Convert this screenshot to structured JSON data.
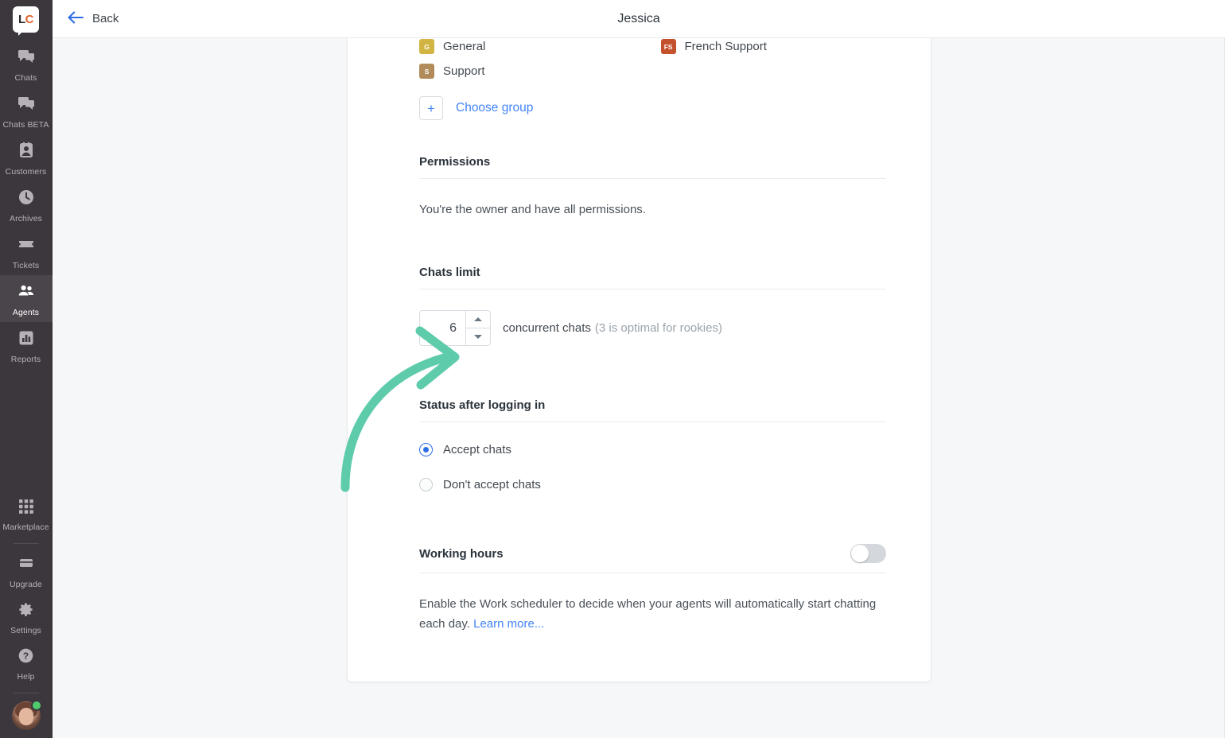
{
  "app": {
    "logo_text_left": "L",
    "logo_text_right": "C",
    "brand_color": "#e1632a"
  },
  "sidebar": {
    "items": [
      {
        "label": "Chats",
        "icon": "chats-icon",
        "active": false
      },
      {
        "label": "Chats BETA",
        "icon": "chats-beta-icon",
        "active": false
      },
      {
        "label": "Customers",
        "icon": "customers-icon",
        "active": false
      },
      {
        "label": "Archives",
        "icon": "archives-clock-icon",
        "active": false
      },
      {
        "label": "Tickets",
        "icon": "tickets-icon",
        "active": false
      },
      {
        "label": "Agents",
        "icon": "agents-icon",
        "active": true
      },
      {
        "label": "Reports",
        "icon": "reports-bar-chart-icon",
        "active": false
      }
    ],
    "bottom_items": [
      {
        "label": "Marketplace",
        "icon": "marketplace-grid-icon"
      },
      {
        "label": "Upgrade",
        "icon": "upgrade-card-icon"
      },
      {
        "label": "Settings",
        "icon": "gear-icon"
      },
      {
        "label": "Help",
        "icon": "question-mark-icon"
      }
    ],
    "avatar": {
      "status": "online",
      "status_color": "#4fcb6e"
    }
  },
  "topbar": {
    "back_label": "Back",
    "back_icon": "arrow-left-icon",
    "title": "Jessica",
    "back_color": "#2f6fe4"
  },
  "groups": {
    "items": [
      {
        "initials": "G",
        "name": "General",
        "color": "#d2b442"
      },
      {
        "initials": "FS",
        "name": "French Support",
        "color": "#c4512e"
      },
      {
        "initials": "S",
        "name": "Support",
        "color": "#b18c5a"
      }
    ],
    "choose_label": "Choose group",
    "plus_icon": "plus-icon"
  },
  "permissions": {
    "title": "Permissions",
    "text": "You're the owner and have all permissions."
  },
  "chats_limit": {
    "title": "Chats limit",
    "value": "6",
    "label": "concurrent chats",
    "hint": "(3 is optimal for rookies)",
    "up_icon": "caret-up-icon",
    "down_icon": "caret-down-icon"
  },
  "status_after_login": {
    "title": "Status after logging in",
    "options": [
      {
        "label": "Accept chats",
        "selected": true
      },
      {
        "label": "Don't accept chats",
        "selected": false
      }
    ],
    "selected_color": "#2f6fe4"
  },
  "working_hours": {
    "title": "Working hours",
    "toggle_on": false,
    "description_before": "Enable the Work scheduler to decide when your agents will automatically start chatting each day. ",
    "learn_more": "Learn more..."
  },
  "annotation": {
    "type": "curved-arrow",
    "color": "#5ecbab",
    "points_to": "chats-limit-stepper"
  }
}
